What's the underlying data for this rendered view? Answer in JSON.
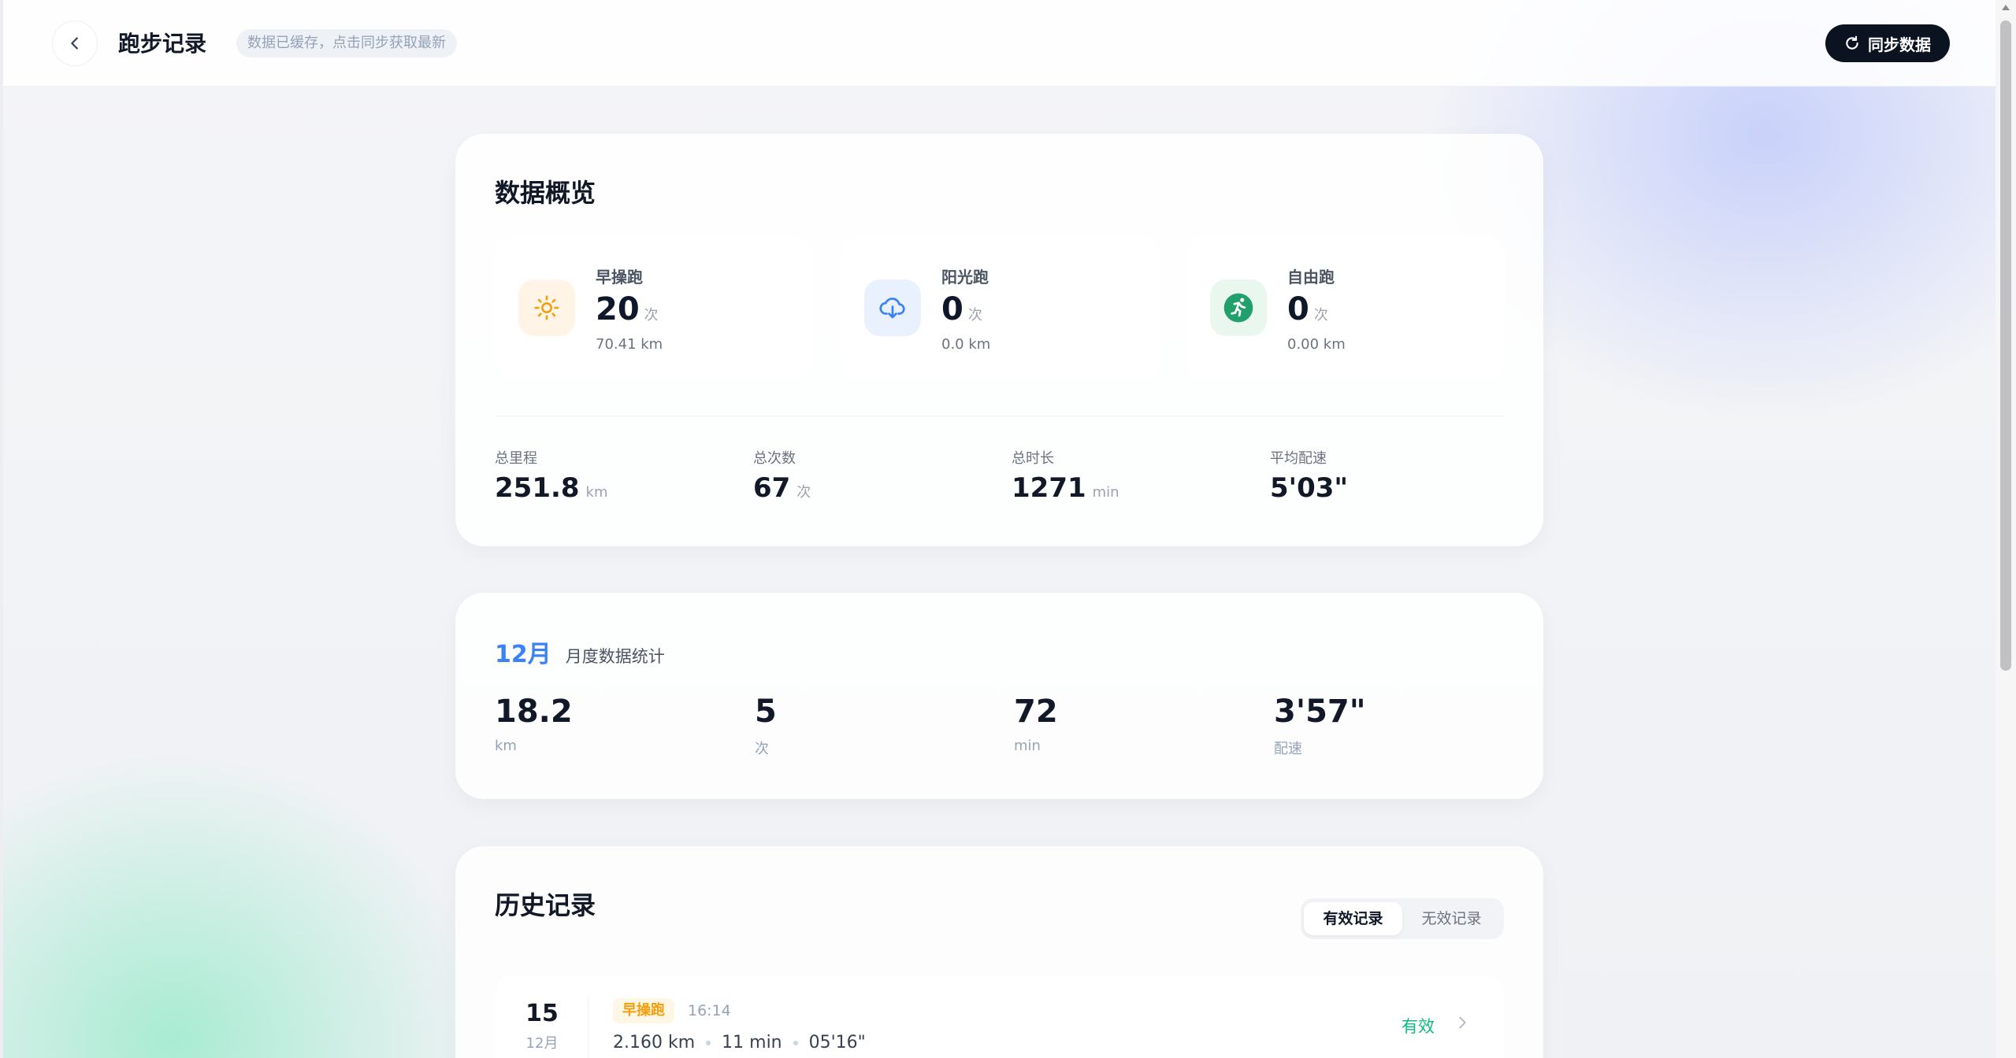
{
  "header": {
    "title": "跑步记录",
    "cache_notice": "数据已缓存，点击同步获取最新",
    "sync_label": "同步数据"
  },
  "overview": {
    "title": "数据概览",
    "types": [
      {
        "name": "早操跑",
        "count": "20",
        "unit": "次",
        "distance": "70.41 km",
        "icon": "sun-icon",
        "color": "#f59e0b"
      },
      {
        "name": "阳光跑",
        "count": "0",
        "unit": "次",
        "distance": "0.0 km",
        "icon": "cloud-download-icon",
        "color": "#3b82f6"
      },
      {
        "name": "自由跑",
        "count": "0",
        "unit": "次",
        "distance": "0.00 km",
        "icon": "runner-icon",
        "color": "#22a06b"
      }
    ],
    "totals": [
      {
        "label": "总里程",
        "value": "251.8",
        "unit": "km"
      },
      {
        "label": "总次数",
        "value": "67",
        "unit": "次"
      },
      {
        "label": "总时长",
        "value": "1271",
        "unit": "min"
      },
      {
        "label": "平均配速",
        "value": "5'03\"",
        "unit": ""
      }
    ]
  },
  "monthly": {
    "month": "12月",
    "subtitle": "月度数据统计",
    "stats": [
      {
        "value": "18.2",
        "unit": "km"
      },
      {
        "value": "5",
        "unit": "次"
      },
      {
        "value": "72",
        "unit": "min"
      },
      {
        "value": "3'57\"",
        "unit": "配速"
      }
    ]
  },
  "history": {
    "title": "历史记录",
    "tabs": [
      "有效记录",
      "无效记录"
    ],
    "active_tab": "有效记录",
    "records": [
      {
        "day": "15",
        "month": "12月",
        "type": "早操跑",
        "time": "16:14",
        "distance": "2.160 km",
        "duration": "11 min",
        "pace": "05'16\"",
        "status": "有效"
      }
    ]
  }
}
